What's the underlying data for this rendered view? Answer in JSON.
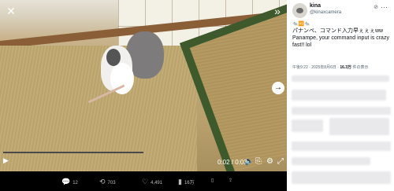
{
  "video": {
    "time": "0:02 / 0:03",
    "progress_fraction": 0.0
  },
  "actions": {
    "replies": "12",
    "reposts": "703",
    "likes": "4,491",
    "views": "16万"
  },
  "tweet": {
    "author_name": "kina",
    "author_handle": "@kinaxcamera",
    "emoji_line": "🐀🆚🐀",
    "text_ja": "パナンペ、コマンド入力早ぇぇぇww",
    "text_en": "Panampe, your command input is crazy fast!! lol",
    "timestamp": "午後9:22 · 2025年8月6日 ·",
    "views_count": "16.3万",
    "views_label": "件の表示"
  },
  "colors": {
    "accent": "#1d9bf0",
    "sidebar_bg": "#ffffff",
    "media_bg": "#000000"
  }
}
